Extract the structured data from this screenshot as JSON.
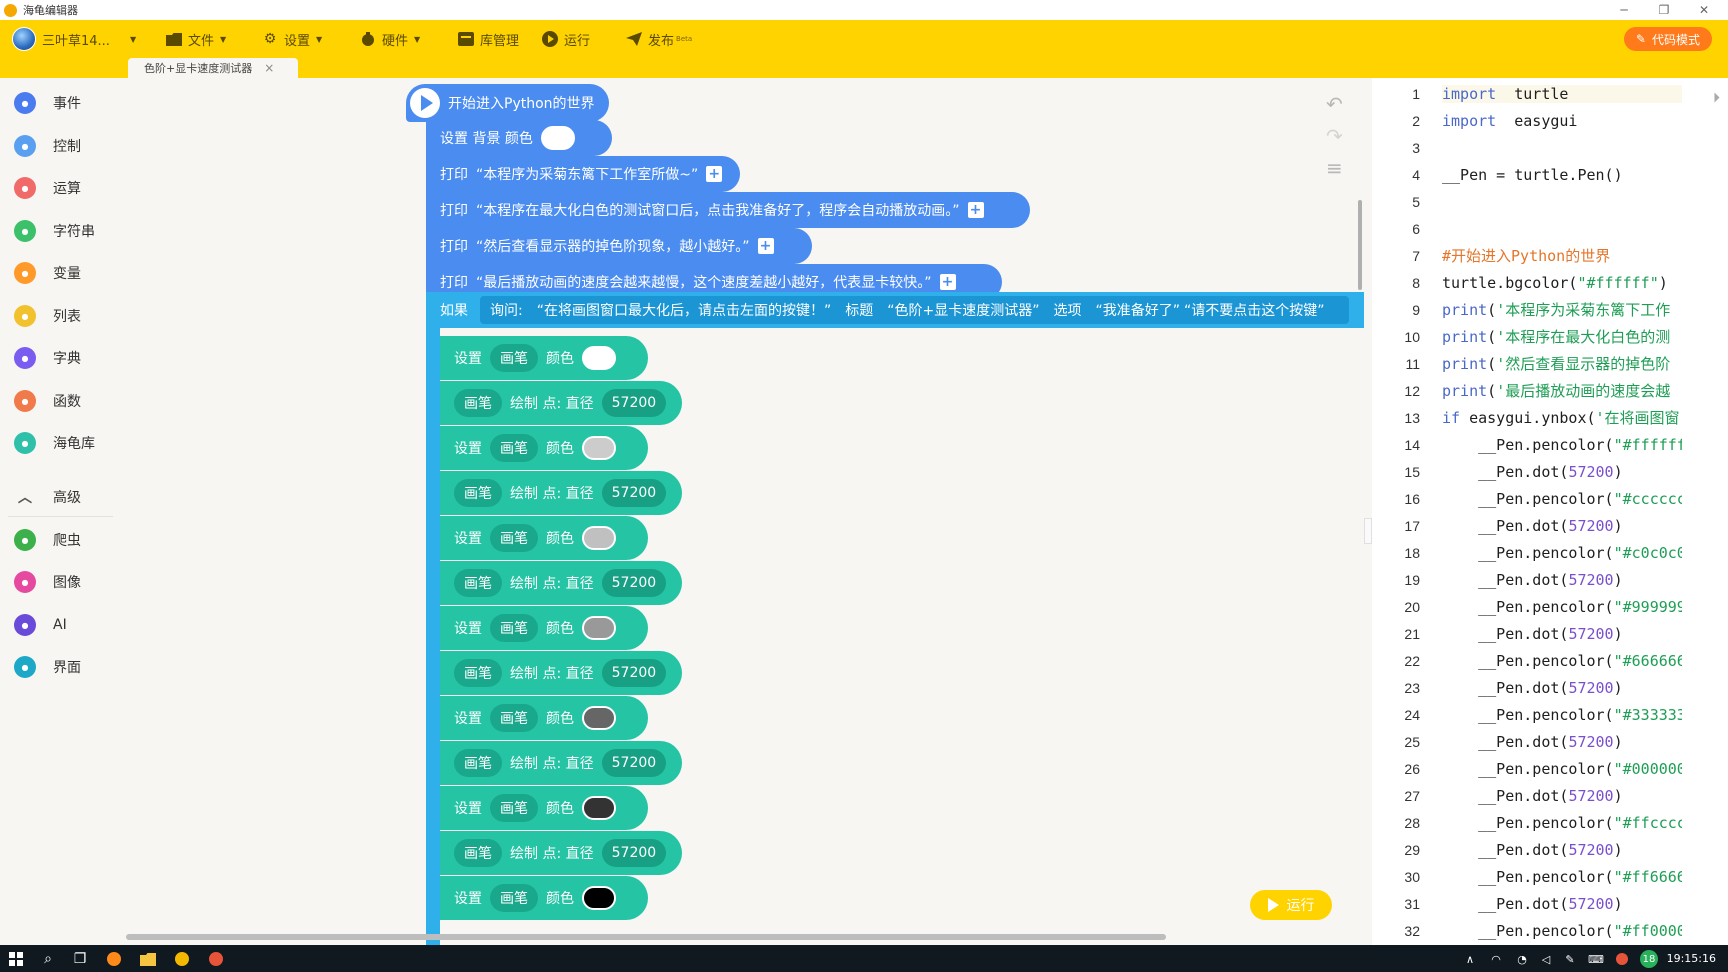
{
  "window": {
    "title": "海龟编辑器",
    "minimize": "─",
    "restore": "❐",
    "close": "✕"
  },
  "toolbar": {
    "user": "三叶草14...",
    "file": "文件",
    "settings": "设置",
    "hardware": "硬件",
    "library": "库管理",
    "run": "运行",
    "publish": "发布",
    "publish_badge": "Beta",
    "code_mode": "代码模式",
    "accent": "#ffd300"
  },
  "tab": {
    "name": "色阶+显卡速度测试器",
    "close": "×"
  },
  "sidebar": {
    "items": [
      {
        "label": "事件",
        "color": "#4a7cf0",
        "icon": "event-icon"
      },
      {
        "label": "控制",
        "color": "#5aa0f0",
        "icon": "gamepad-icon"
      },
      {
        "label": "运算",
        "color": "#f06a6a",
        "icon": "calc-icon"
      },
      {
        "label": "字符串",
        "color": "#3cc06a",
        "icon": "text-icon"
      },
      {
        "label": "变量",
        "color": "#ff9a2a",
        "icon": "variable-icon"
      },
      {
        "label": "列表",
        "color": "#f2c12e",
        "icon": "list-icon"
      },
      {
        "label": "字典",
        "color": "#7a5cf0",
        "icon": "book-icon"
      },
      {
        "label": "函数",
        "color": "#f07a4a",
        "icon": "function-icon"
      },
      {
        "label": "海龟库",
        "color": "#2ec0a8",
        "icon": "turtle-icon"
      },
      {
        "label": "高级",
        "color": "#888888",
        "icon": "chevron-up-icon"
      },
      {
        "label": "爬虫",
        "color": "#3cb04a",
        "icon": "spider-icon"
      },
      {
        "label": "图像",
        "color": "#e64aa0",
        "icon": "image-icon"
      },
      {
        "label": "AI",
        "color": "#6a4ad8",
        "icon": "ai-icon"
      },
      {
        "label": "界面",
        "color": "#1ea8c8",
        "icon": "window-icon"
      }
    ]
  },
  "blocks": {
    "hat": "开始进入Python的世界",
    "set_bg": "设置 背景 颜色",
    "print_label": "打印",
    "prints": [
      "“本程序为采菊东篱下工作室所做~”",
      "“本程序在最大化白色的测试窗口后，点击我准备好了，程序会自动播放动画。”",
      "“然后查看显示器的掉色阶现象，越小越好。”",
      "“最后播放动画的速度会越来越慢，这个速度差越小越好，代表显卡较快。”"
    ],
    "if_label": "如果",
    "ask_label": "询问:",
    "ask_text": "“在将画图窗口最大化后，请点击左面的按键！”",
    "title_label": "标题",
    "title_text": "“色阶+显卡速度测试器”",
    "options_label": "选项",
    "option_1": "“我准备好了”",
    "option_2": "“请不要点击这个按键”",
    "set_label": "设置",
    "pen_label": "画笔",
    "color_label": "颜色",
    "dot_label": "绘制 点: 直径",
    "diameter": "57200",
    "swatches": [
      "#ffffff",
      "#cccccc",
      "#c0c0c0",
      "#999999",
      "#666666",
      "#333333",
      "#000000"
    ],
    "run": "运行"
  },
  "code": {
    "lines": [
      {
        "n": "1",
        "parts": [
          [
            "kw",
            "import"
          ],
          [
            "",
            "  turtle"
          ]
        ]
      },
      {
        "n": "2",
        "parts": [
          [
            "kw",
            "import"
          ],
          [
            "",
            "  easygui"
          ]
        ]
      },
      {
        "n": "3",
        "parts": []
      },
      {
        "n": "4",
        "parts": [
          [
            "",
            "__Pen = turtle.Pen()"
          ]
        ]
      },
      {
        "n": "5",
        "parts": []
      },
      {
        "n": "6",
        "parts": []
      },
      {
        "n": "7",
        "parts": [
          [
            "cm",
            "#开始进入Python的世界"
          ]
        ]
      },
      {
        "n": "8",
        "parts": [
          [
            "",
            "turtle.bgcolor("
          ],
          [
            "st",
            "\"#ffffff\""
          ],
          [
            "",
            ")"
          ]
        ]
      },
      {
        "n": "9",
        "parts": [
          [
            "kw",
            "print"
          ],
          [
            "",
            "("
          ],
          [
            "st",
            "'本程序为采菊东篱下工作"
          ]
        ]
      },
      {
        "n": "10",
        "parts": [
          [
            "kw",
            "print"
          ],
          [
            "",
            "("
          ],
          [
            "st",
            "'本程序在最大化白色的测"
          ]
        ]
      },
      {
        "n": "11",
        "parts": [
          [
            "kw",
            "print"
          ],
          [
            "",
            "("
          ],
          [
            "st",
            "'然后查看显示器的掉色阶"
          ]
        ]
      },
      {
        "n": "12",
        "parts": [
          [
            "kw",
            "print"
          ],
          [
            "",
            "("
          ],
          [
            "st",
            "'最后播放动画的速度会越"
          ]
        ]
      },
      {
        "n": "13",
        "parts": [
          [
            "kw",
            "if"
          ],
          [
            "",
            " easygui.ynbox("
          ],
          [
            "st",
            "'在将画图窗"
          ]
        ]
      },
      {
        "n": "14",
        "parts": [
          [
            "",
            "    __Pen.pencolor("
          ],
          [
            "st",
            "\"#ffffff"
          ]
        ]
      },
      {
        "n": "15",
        "parts": [
          [
            "",
            "    __Pen.dot("
          ],
          [
            "nm",
            "57200"
          ],
          [
            "",
            ")"
          ]
        ]
      },
      {
        "n": "16",
        "parts": [
          [
            "",
            "    __Pen.pencolor("
          ],
          [
            "st",
            "\"#cccccc"
          ]
        ]
      },
      {
        "n": "17",
        "parts": [
          [
            "",
            "    __Pen.dot("
          ],
          [
            "nm",
            "57200"
          ],
          [
            "",
            ")"
          ]
        ]
      },
      {
        "n": "18",
        "parts": [
          [
            "",
            "    __Pen.pencolor("
          ],
          [
            "st",
            "\"#c0c0c0"
          ]
        ]
      },
      {
        "n": "19",
        "parts": [
          [
            "",
            "    __Pen.dot("
          ],
          [
            "nm",
            "57200"
          ],
          [
            "",
            ")"
          ]
        ]
      },
      {
        "n": "20",
        "parts": [
          [
            "",
            "    __Pen.pencolor("
          ],
          [
            "st",
            "\"#999999"
          ]
        ]
      },
      {
        "n": "21",
        "parts": [
          [
            "",
            "    __Pen.dot("
          ],
          [
            "nm",
            "57200"
          ],
          [
            "",
            ")"
          ]
        ]
      },
      {
        "n": "22",
        "parts": [
          [
            "",
            "    __Pen.pencolor("
          ],
          [
            "st",
            "\"#666666"
          ]
        ]
      },
      {
        "n": "23",
        "parts": [
          [
            "",
            "    __Pen.dot("
          ],
          [
            "nm",
            "57200"
          ],
          [
            "",
            ")"
          ]
        ]
      },
      {
        "n": "24",
        "parts": [
          [
            "",
            "    __Pen.pencolor("
          ],
          [
            "st",
            "\"#333333"
          ]
        ]
      },
      {
        "n": "25",
        "parts": [
          [
            "",
            "    __Pen.dot("
          ],
          [
            "nm",
            "57200"
          ],
          [
            "",
            ")"
          ]
        ]
      },
      {
        "n": "26",
        "parts": [
          [
            "",
            "    __Pen.pencolor("
          ],
          [
            "st",
            "\"#000000"
          ]
        ]
      },
      {
        "n": "27",
        "parts": [
          [
            "",
            "    __Pen.dot("
          ],
          [
            "nm",
            "57200"
          ],
          [
            "",
            ")"
          ]
        ]
      },
      {
        "n": "28",
        "parts": [
          [
            "",
            "    __Pen.pencolor("
          ],
          [
            "st",
            "\"#ffcccc"
          ]
        ]
      },
      {
        "n": "29",
        "parts": [
          [
            "",
            "    __Pen.dot("
          ],
          [
            "nm",
            "57200"
          ],
          [
            "",
            ")"
          ]
        ]
      },
      {
        "n": "30",
        "parts": [
          [
            "",
            "    __Pen.pencolor("
          ],
          [
            "st",
            "\"#ff6666"
          ]
        ]
      },
      {
        "n": "31",
        "parts": [
          [
            "",
            "    __Pen.dot("
          ],
          [
            "nm",
            "57200"
          ],
          [
            "",
            ")"
          ]
        ]
      },
      {
        "n": "32",
        "parts": [
          [
            "",
            "    __Pen.pencolor("
          ],
          [
            "st",
            "\"#ff0000"
          ]
        ]
      }
    ]
  },
  "taskbar": {
    "clock": "19:15:16",
    "badge": "18"
  }
}
